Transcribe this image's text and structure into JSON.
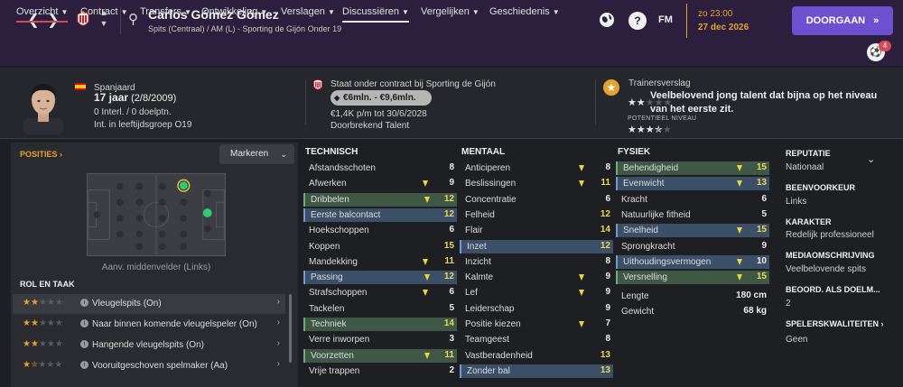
{
  "player": {
    "name": "Carlos Gómez Gómez",
    "subtitle": "Spits (Centraal) / AM (L) - Sporting de Gijón Onder 19"
  },
  "top": {
    "date_time": "zo 23:00",
    "date": "27 dec 2026",
    "continue_label": "DOORGAAN",
    "fm_label": "FM",
    "help_label": "?",
    "notif_count": "4"
  },
  "tabs": [
    {
      "label": "Overzicht"
    },
    {
      "label": "Contract"
    },
    {
      "label": "Transfers"
    },
    {
      "label": "Ontwikkeling"
    },
    {
      "label": "Verslagen"
    },
    {
      "label": "Discussiëren"
    },
    {
      "label": "Vergelijken"
    },
    {
      "label": "Geschiedenis"
    }
  ],
  "header": {
    "nationality": "Spanjaard",
    "age_main": "17 jaar",
    "age_dob": "(2/8/2009)",
    "intl": "0 Interl. / 0 doelptn.",
    "youth": "Int. in leeftijdsgroep O19",
    "contract_status": "Staat onder contract bij Sporting de Gijón",
    "value": "€6mln. - €9,6mln.",
    "wage": "€1,4K p/m tot 30/6/2028",
    "breakthrough": "Doorbrekend Talent",
    "coach_title": "Trainersverslag",
    "coach_report": "Veelbelovend jong talent dat bijna op het niveau van het eerste zit.",
    "potential_label": "POTENTIEEL NIVEAU",
    "ability_stars": 2,
    "potential_stars": 3.5
  },
  "positions": {
    "title": "POSITIES",
    "marker_label": "Markeren",
    "pitch_label": "Aanv. middenvelder (Links)"
  },
  "roles": {
    "title": "ROL EN TAAK",
    "items": [
      {
        "name": "Vleugelspits (On)",
        "stars": 2
      },
      {
        "name": "Naar binnen komende vleugelspeler (On)",
        "stars": 2
      },
      {
        "name": "Hangende vleugelspits (On)",
        "stars": 2
      },
      {
        "name": "Vooruitgeschoven spelmaker (Aa)",
        "stars": 1.5
      }
    ]
  },
  "attributes": {
    "technical": {
      "title": "TECHNISCH",
      "rows": [
        {
          "name": "Afstandsschoten",
          "value": "8",
          "up": false,
          "hl": "none"
        },
        {
          "name": "Afwerken",
          "value": "9",
          "up": true,
          "hl": "none"
        },
        {
          "name": "Dribbelen",
          "value": "12",
          "up": true,
          "hl": "green"
        },
        {
          "name": "Eerste balcontact",
          "value": "12",
          "up": false,
          "hl": "blue"
        },
        {
          "name": "Hoekschoppen",
          "value": "6",
          "up": false,
          "hl": "none"
        },
        {
          "name": "Koppen",
          "value": "15",
          "up": false,
          "hl": "none"
        },
        {
          "name": "Mandekking",
          "value": "11",
          "up": true,
          "hl": "none"
        },
        {
          "name": "Passing",
          "value": "12",
          "up": true,
          "hl": "blue"
        },
        {
          "name": "Strafschoppen",
          "value": "6",
          "up": true,
          "hl": "none"
        },
        {
          "name": "Tackelen",
          "value": "5",
          "up": false,
          "hl": "none"
        },
        {
          "name": "Techniek",
          "value": "14",
          "up": false,
          "hl": "green"
        },
        {
          "name": "Verre inworpen",
          "value": "3",
          "up": false,
          "hl": "none"
        },
        {
          "name": "Voorzetten",
          "value": "11",
          "up": true,
          "hl": "green"
        },
        {
          "name": "Vrije trappen",
          "value": "2",
          "up": false,
          "hl": "none"
        }
      ]
    },
    "mental": {
      "title": "MENTAAL",
      "rows": [
        {
          "name": "Anticiperen",
          "value": "8",
          "up": true,
          "hl": "none"
        },
        {
          "name": "Beslissingen",
          "value": "11",
          "up": true,
          "hl": "none"
        },
        {
          "name": "Concentratie",
          "value": "6",
          "up": false,
          "hl": "none"
        },
        {
          "name": "Felheid",
          "value": "12",
          "up": false,
          "hl": "none"
        },
        {
          "name": "Flair",
          "value": "14",
          "up": false,
          "hl": "none"
        },
        {
          "name": "Inzet",
          "value": "12",
          "up": false,
          "hl": "blue"
        },
        {
          "name": "Inzicht",
          "value": "8",
          "up": false,
          "hl": "none"
        },
        {
          "name": "Kalmte",
          "value": "9",
          "up": true,
          "hl": "none"
        },
        {
          "name": "Lef",
          "value": "9",
          "up": true,
          "hl": "none"
        },
        {
          "name": "Leiderschap",
          "value": "9",
          "up": false,
          "hl": "none"
        },
        {
          "name": "Positie kiezen",
          "value": "7",
          "up": true,
          "hl": "none"
        },
        {
          "name": "Teamgeest",
          "value": "8",
          "up": false,
          "hl": "none"
        },
        {
          "name": "Vastberadenheid",
          "value": "13",
          "up": false,
          "hl": "none"
        },
        {
          "name": "Zonder bal",
          "value": "13",
          "up": false,
          "hl": "blue"
        }
      ]
    },
    "physical": {
      "title": "FYSIEK",
      "rows": [
        {
          "name": "Behendigheid",
          "value": "15",
          "up": true,
          "hl": "green"
        },
        {
          "name": "Evenwicht",
          "value": "13",
          "up": true,
          "hl": "blue"
        },
        {
          "name": "Kracht",
          "value": "6",
          "up": false,
          "hl": "none"
        },
        {
          "name": "Natuurlijke fitheid",
          "value": "5",
          "up": false,
          "hl": "none"
        },
        {
          "name": "Snelheid",
          "value": "15",
          "up": true,
          "hl": "blue"
        },
        {
          "name": "Sprongkracht",
          "value": "9",
          "up": false,
          "hl": "none"
        },
        {
          "name": "Uithoudingsvermogen",
          "value": "10",
          "up": true,
          "hl": "blue"
        },
        {
          "name": "Versnelling",
          "value": "15",
          "up": true,
          "hl": "green"
        }
      ],
      "height_label": "Lengte",
      "height_value": "180 cm",
      "weight_label": "Gewicht",
      "weight_value": "68 kg"
    }
  },
  "side": {
    "reputation_label": "REPUTATIE",
    "reputation_value": "Nationaal",
    "foot_label": "BEENVOORKEUR",
    "foot_value": "Links",
    "character_label": "KARAKTER",
    "character_value": "Redelijk professioneel",
    "media_label": "MEDIAOMSCHRIJVING",
    "media_value": "Veelbelovende spits",
    "rating_label": "BEOORD. ALS DOELM...",
    "rating_value": "2",
    "traits_label": "SPELERSKWALITEITEN",
    "traits_value": "Geen"
  },
  "colors": {
    "accent_purple": "#6d4fd0",
    "accent_orange": "#e2a331",
    "highlight_green": "#3f5846",
    "highlight_blue": "#3b4f66",
    "value_yellow": "#ecd95a"
  }
}
